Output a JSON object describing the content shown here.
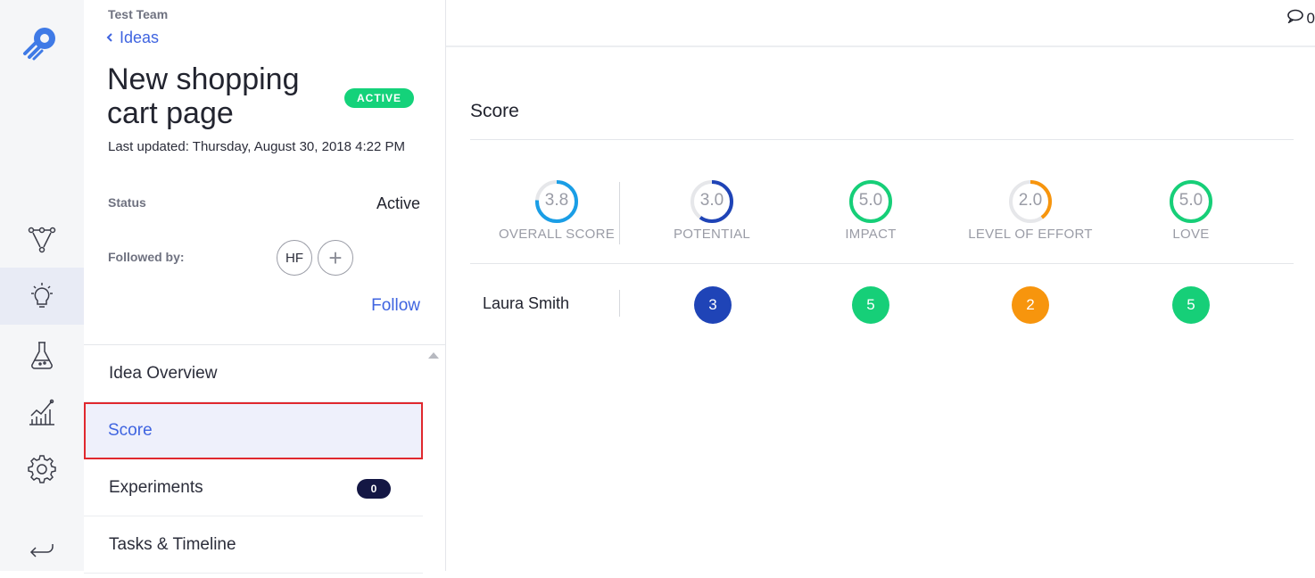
{
  "header": {
    "team": "Test Team",
    "back_label": "Ideas",
    "comment_count": "0"
  },
  "idea": {
    "title": "New shopping cart page",
    "state_badge": "ACTIVE",
    "last_updated": "Last updated: Thursday, August 30, 2018 4:22 PM",
    "status_label": "Status",
    "status_value": "Active",
    "followed_label": "Followed by:",
    "follower_initials": "HF",
    "add_follower_symbol": "+",
    "follow_label": "Follow"
  },
  "menu": {
    "items": [
      {
        "label": "Idea Overview"
      },
      {
        "label": "Score"
      },
      {
        "label": "Experiments",
        "count": "0"
      },
      {
        "label": "Tasks & Timeline"
      }
    ]
  },
  "score": {
    "title": "Score",
    "columns": [
      {
        "label": "OVERALL SCORE",
        "value": "3.8",
        "fraction": 0.76,
        "color": "#1a9ee6"
      },
      {
        "label": "POTENTIAL",
        "value": "3.0",
        "fraction": 0.6,
        "color": "#1f44b7"
      },
      {
        "label": "IMPACT",
        "value": "5.0",
        "fraction": 1.0,
        "color": "#16cf78"
      },
      {
        "label": "LEVEL OF EFFORT",
        "value": "2.0",
        "fraction": 0.4,
        "color": "#f7950d"
      },
      {
        "label": "LOVE",
        "value": "5.0",
        "fraction": 1.0,
        "color": "#16cf78"
      }
    ],
    "voters": [
      {
        "name": "Laura Smith",
        "scores": [
          "3",
          "5",
          "2",
          "5"
        ]
      }
    ]
  },
  "icons": {
    "logo": "rocket-logo-icon",
    "nav": [
      "flow-icon",
      "lightbulb-icon",
      "flask-icon",
      "chart-icon",
      "gear-icon",
      "return-icon"
    ],
    "comment": "comment-icon"
  },
  "colors": {
    "accent": "#3f64e0",
    "active_badge": "#14d27a",
    "selected_border": "#e0282e"
  }
}
